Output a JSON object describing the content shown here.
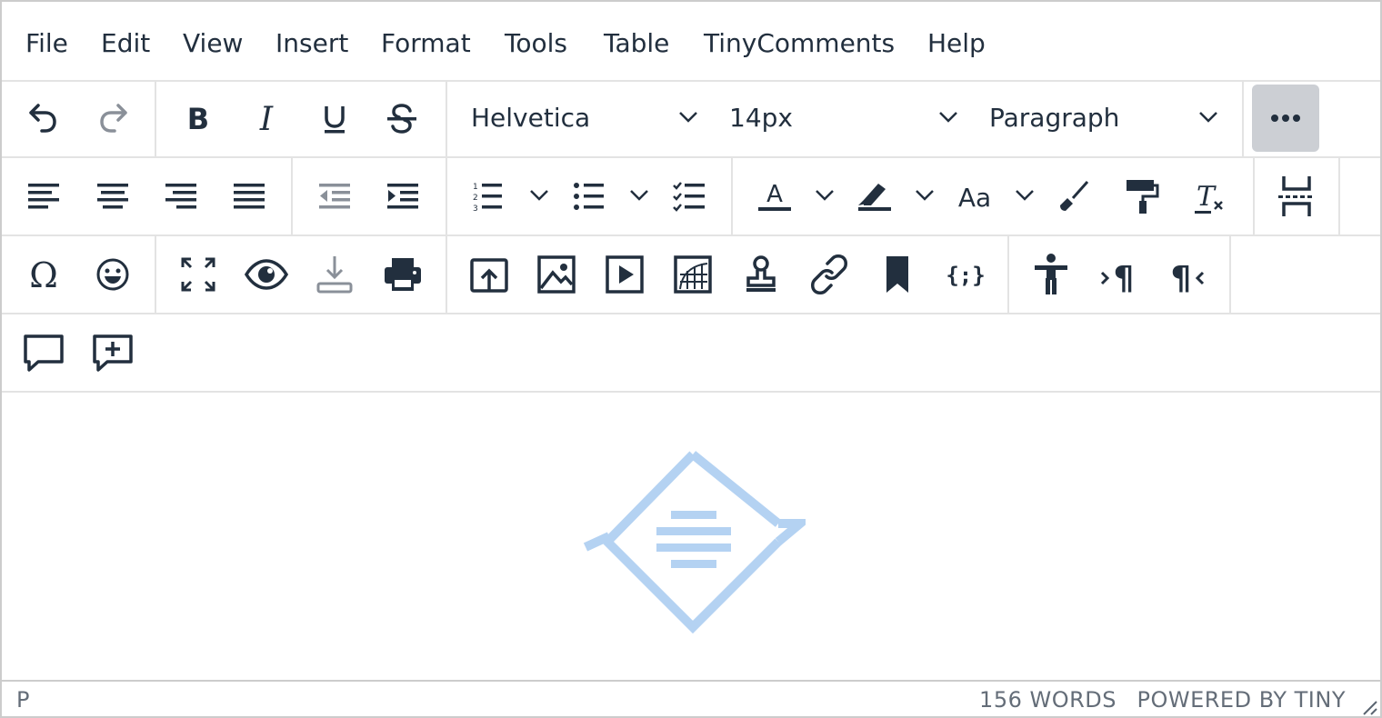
{
  "menubar": {
    "items": [
      "File",
      "Edit",
      "View",
      "Insert",
      "Format",
      "Tools",
      "Table",
      "TinyComments",
      "Help"
    ]
  },
  "toolbar": {
    "font_family": "Helvetica",
    "font_size": "14px",
    "block_format": "Paragraph",
    "icons": {
      "undo": "undo-icon",
      "redo": "redo-icon",
      "bold": "bold-icon",
      "italic": "italic-icon",
      "underline": "underline-icon",
      "strikethrough": "strikethrough-icon",
      "more": "more-icon"
    }
  },
  "statusbar": {
    "path": "P",
    "word_count": "156 WORDS",
    "branding": "POWERED BY TINY"
  },
  "colors": {
    "icon": "#222f3e",
    "icon_disabled": "#8a9099",
    "border": "#e3e3e3",
    "more_bg": "#cccfd4",
    "watermark": "#b4d2f2"
  }
}
